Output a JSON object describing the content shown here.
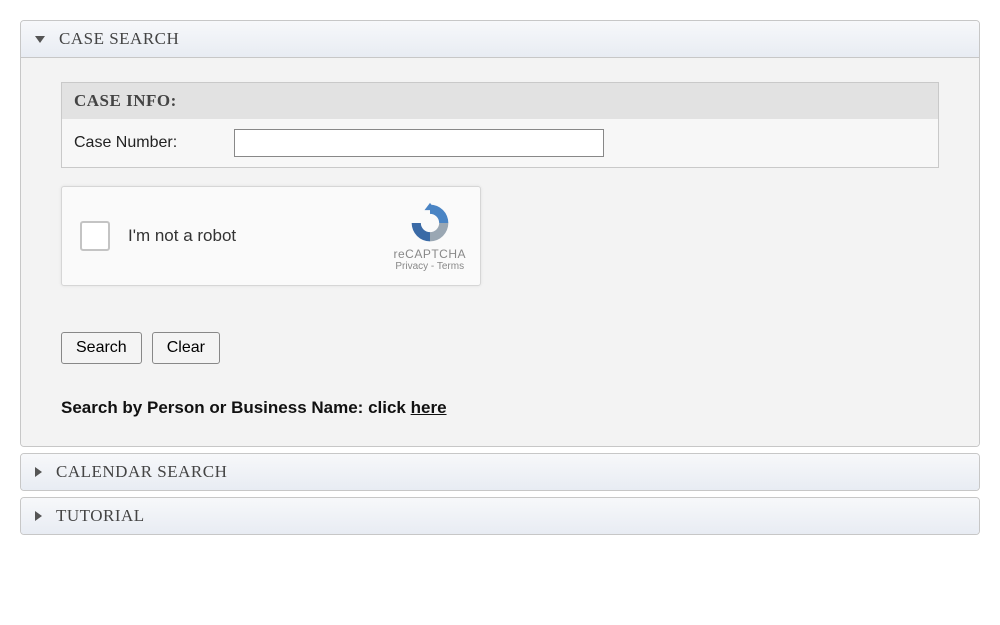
{
  "sections": {
    "case_search": {
      "title": "CASE SEARCH",
      "info_heading": "CASE INFO:",
      "case_number_label": "Case Number:",
      "case_number_value": ""
    },
    "calendar_search": {
      "title": "CALENDAR SEARCH"
    },
    "tutorial": {
      "title": "TUTORIAL"
    }
  },
  "recaptcha": {
    "label": "I'm not a robot",
    "brand": "reCAPTCHA",
    "links": "Privacy - Terms"
  },
  "buttons": {
    "search": "Search",
    "clear": "Clear"
  },
  "alt_search": {
    "prefix": "Search by Person or Business Name: click ",
    "link": "here"
  }
}
